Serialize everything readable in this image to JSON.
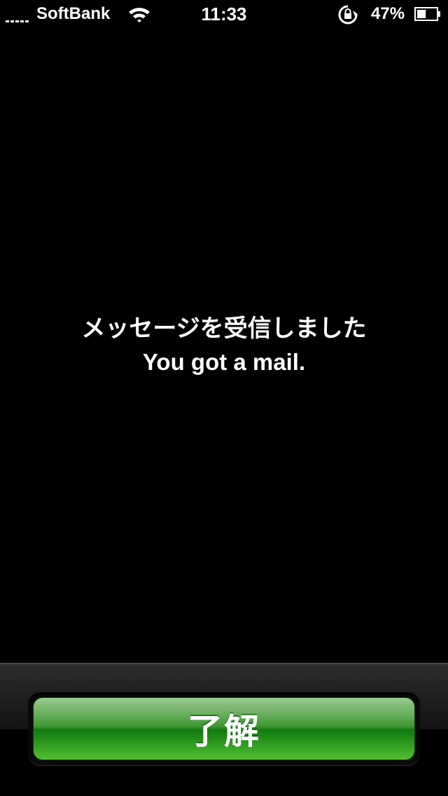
{
  "status_bar": {
    "carrier": "SoftBank",
    "time": "11:33",
    "battery_percent": "47%",
    "battery_level": 0.47,
    "signal_icon": "signal-bars-icon",
    "wifi_icon": "wifi-icon",
    "orientation_lock_icon": "rotation-lock-icon",
    "battery_icon": "battery-icon"
  },
  "message": {
    "japanese": "メッセージを受信しました",
    "english": "You got a mail."
  },
  "action": {
    "ok_label": "了解",
    "button_color": "#3f9833"
  }
}
